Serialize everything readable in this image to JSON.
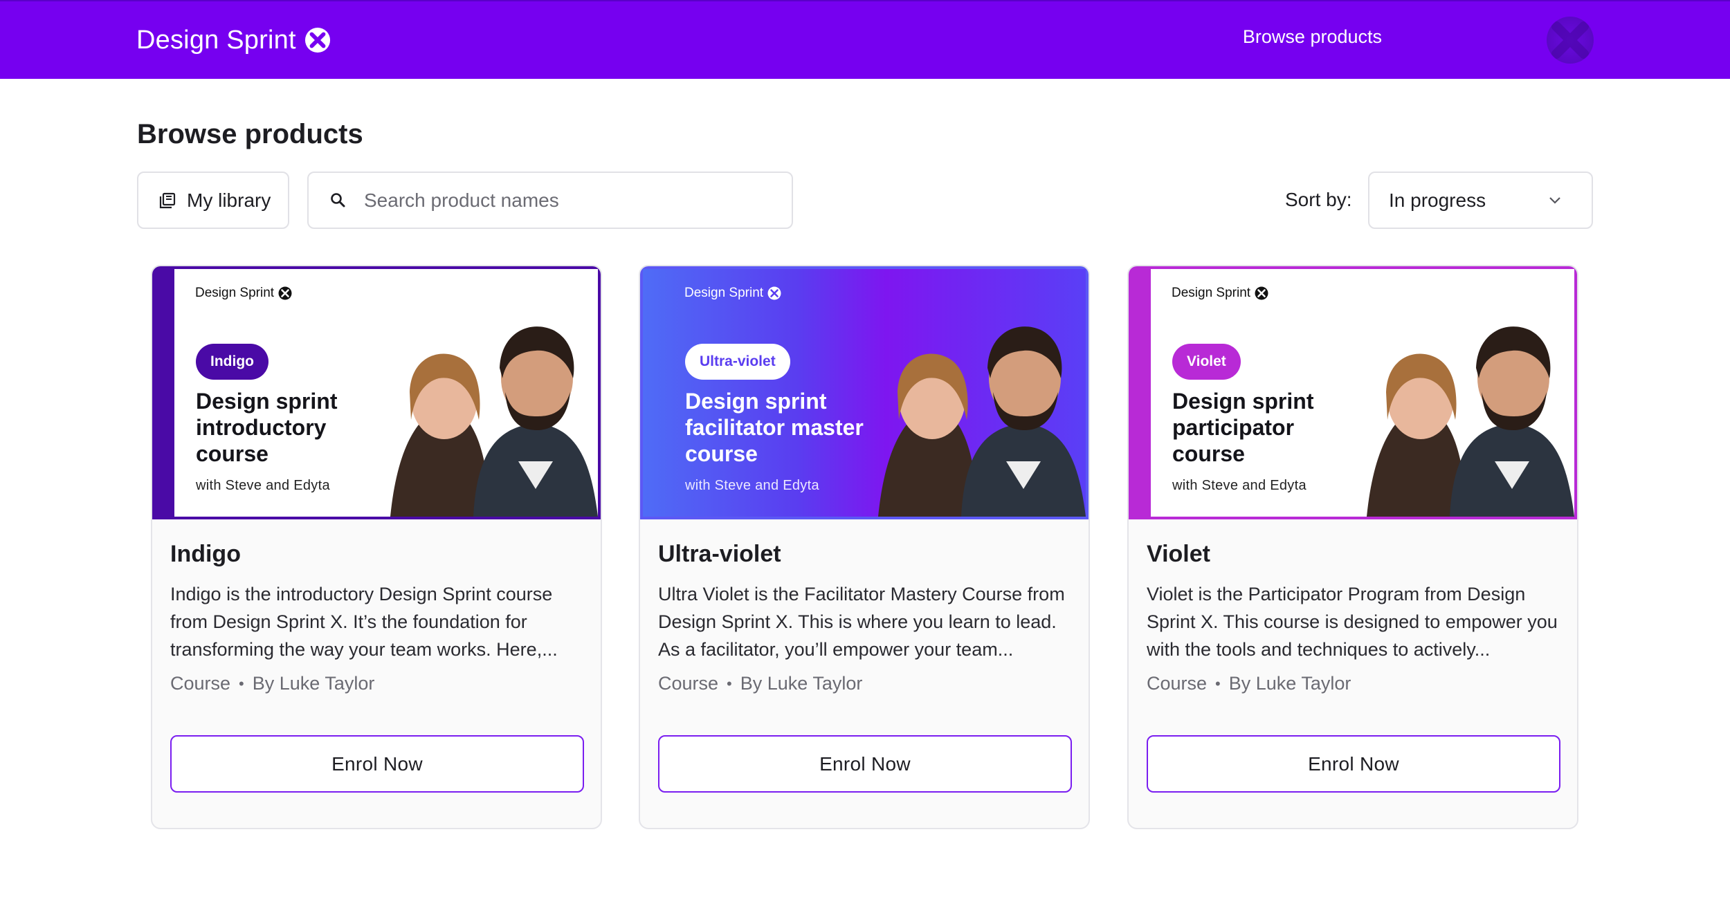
{
  "app": {
    "brand_name": "Design Sprint",
    "brand_mark_icon": "x-logo-icon",
    "nav_link": "Browse products",
    "avatar_icon": "user-avatar-icon",
    "colors": {
      "topbar": "#7600f0",
      "indigo": "#4a0aa6",
      "ultra_violet": "#5c58f5",
      "violet": "#b82ad6",
      "button_border": "#7a1ef0"
    }
  },
  "header": {
    "title": "Browse products",
    "library_button": "My library",
    "library_icon": "library-icon",
    "search_icon": "search-icon",
    "search_placeholder": "Search product names",
    "search_value": "",
    "sort_label": "Sort by:",
    "sort_value": "In progress",
    "sort_icon": "chevron-down-icon"
  },
  "products": [
    {
      "banner": {
        "brand": "Design Sprint",
        "badge": "Indigo",
        "title": "Design sprint introductory course",
        "subtitle": "with Steve and Edyta"
      },
      "name": "Indigo",
      "description": "Indigo is the introductory Design Sprint course from Design Sprint X. It’s the foundation for transforming the way your team works. Here,...",
      "type": "Course",
      "author": "By Luke Taylor",
      "cta": "Enrol Now"
    },
    {
      "banner": {
        "brand": "Design Sprint",
        "badge": "Ultra-violet",
        "title": "Design sprint facilitator master course",
        "subtitle": "with Steve and Edyta"
      },
      "name": "Ultra-violet",
      "description": "Ultra Violet is the Facilitator Mastery Course from Design Sprint X. This is where you learn to lead. As a facilitator, you’ll empower your team...",
      "type": "Course",
      "author": "By Luke Taylor",
      "cta": "Enrol Now"
    },
    {
      "banner": {
        "brand": "Design Sprint",
        "badge": "Violet",
        "title": "Design sprint participator course",
        "subtitle": "with Steve and Edyta"
      },
      "name": "Violet",
      "description": "Violet is the Participator Program from Design Sprint X. This course is designed to empower you with the tools and techniques to actively...",
      "type": "Course",
      "author": "By Luke Taylor",
      "cta": "Enrol Now"
    }
  ]
}
